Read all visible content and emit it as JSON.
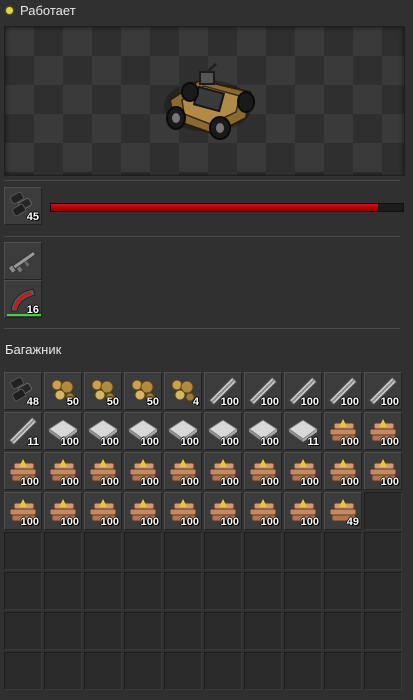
{
  "status": {
    "text": "Работает",
    "color": "#d9d84a"
  },
  "vehicle": {
    "health_fraction": 0.93,
    "health_color": "#c81010"
  },
  "ammo_slot": {
    "icon": "ammo-icon",
    "count": "45"
  },
  "weapon_slot": {
    "icon": "rifle-icon"
  },
  "fuel_slot": {
    "icon": "fuel-icon",
    "count": "16"
  },
  "trunk": {
    "title": "Багажник",
    "rows": [
      [
        {
          "item": "ammo",
          "count": "48"
        },
        {
          "item": "ore",
          "count": "50"
        },
        {
          "item": "ore",
          "count": "50"
        },
        {
          "item": "ore",
          "count": "50"
        },
        {
          "item": "ore",
          "count": "4"
        },
        {
          "item": "rail",
          "count": "100"
        },
        {
          "item": "rail",
          "count": "100"
        },
        {
          "item": "rail",
          "count": "100"
        },
        {
          "item": "rail",
          "count": "100"
        },
        {
          "item": "rail",
          "count": "100"
        }
      ],
      [
        {
          "item": "rail",
          "count": "11"
        },
        {
          "item": "plate",
          "count": "100"
        },
        {
          "item": "plate",
          "count": "100"
        },
        {
          "item": "plate",
          "count": "100"
        },
        {
          "item": "plate",
          "count": "100"
        },
        {
          "item": "plate",
          "count": "100"
        },
        {
          "item": "plate",
          "count": "100"
        },
        {
          "item": "plate",
          "count": "11"
        },
        {
          "item": "planks",
          "count": "100"
        },
        {
          "item": "planks",
          "count": "100"
        }
      ],
      [
        {
          "item": "planks",
          "count": "100"
        },
        {
          "item": "planks",
          "count": "100"
        },
        {
          "item": "planks",
          "count": "100"
        },
        {
          "item": "planks",
          "count": "100"
        },
        {
          "item": "planks",
          "count": "100"
        },
        {
          "item": "planks",
          "count": "100"
        },
        {
          "item": "planks",
          "count": "100"
        },
        {
          "item": "planks",
          "count": "100"
        },
        {
          "item": "planks",
          "count": "100"
        },
        {
          "item": "planks",
          "count": "100"
        }
      ],
      [
        {
          "item": "planks",
          "count": "100"
        },
        {
          "item": "planks",
          "count": "100"
        },
        {
          "item": "planks",
          "count": "100"
        },
        {
          "item": "planks",
          "count": "100"
        },
        {
          "item": "planks",
          "count": "100"
        },
        {
          "item": "planks",
          "count": "100"
        },
        {
          "item": "planks",
          "count": "100"
        },
        {
          "item": "planks",
          "count": "100"
        },
        {
          "item": "planks",
          "count": "49"
        },
        null
      ],
      [
        null,
        null,
        null,
        null,
        null,
        null,
        null,
        null,
        null,
        null
      ],
      [
        null,
        null,
        null,
        null,
        null,
        null,
        null,
        null,
        null,
        null
      ],
      [
        null,
        null,
        null,
        null,
        null,
        null,
        null,
        null,
        null,
        null
      ],
      [
        null,
        null,
        null,
        null,
        null,
        null,
        null,
        null,
        null,
        null
      ]
    ]
  }
}
